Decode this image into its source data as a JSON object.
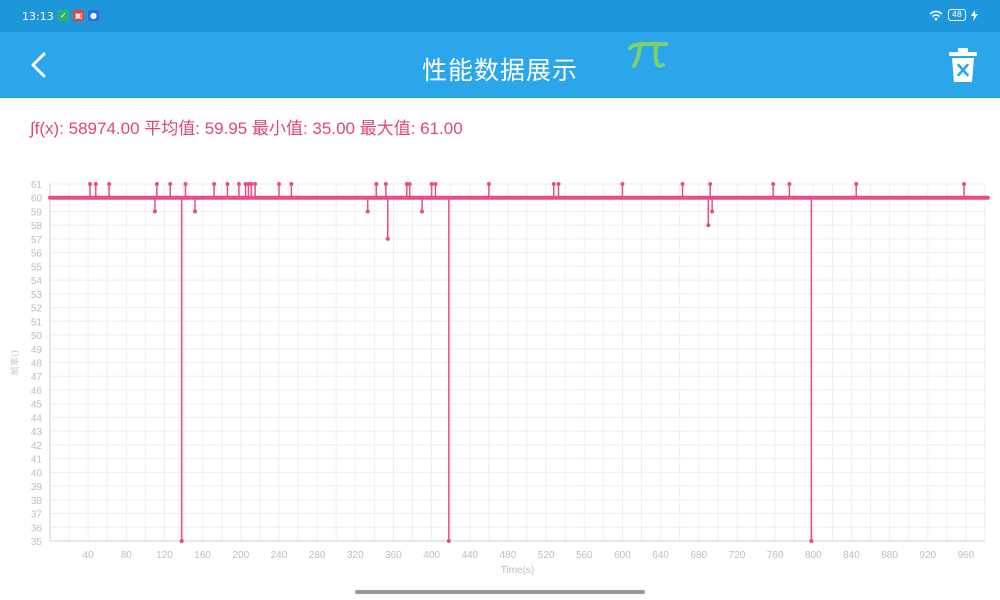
{
  "status_bar": {
    "time": "13:13",
    "battery": "48",
    "colors": {
      "background": "#1e96dc"
    }
  },
  "app_bar": {
    "title": "性能数据展示",
    "back_icon": "chevron-left-icon",
    "delete_icon": "trash-icon",
    "logo_icon": "pi-logo-icon",
    "colors": {
      "background": "#2ba6eb",
      "text": "#ffffff"
    }
  },
  "stats": {
    "text": "∫f(x): 58974.00 平均值: 59.95 最小值: 35.00 最大值: 61.00",
    "color": "#e0457b"
  },
  "chart_data": {
    "type": "line",
    "xlabel": "Time(s)",
    "ylabel": "帧率()",
    "xlim": [
      0,
      980
    ],
    "ylim": [
      35,
      61
    ],
    "xticks": [
      40,
      80,
      120,
      160,
      200,
      240,
      280,
      320,
      360,
      400,
      440,
      480,
      520,
      560,
      600,
      640,
      680,
      720,
      760,
      800,
      840,
      880,
      920,
      960
    ],
    "yticks": [
      35,
      36,
      37,
      38,
      39,
      40,
      41,
      42,
      43,
      44,
      45,
      46,
      47,
      48,
      49,
      50,
      51,
      52,
      53,
      54,
      55,
      56,
      57,
      58,
      59,
      60,
      61
    ],
    "grid": true,
    "color": "#ea4c89",
    "baseline": 60,
    "x_end": 983,
    "deviations": [
      {
        "x": 42,
        "y": 61
      },
      {
        "x": 48,
        "y": 61
      },
      {
        "x": 62,
        "y": 61
      },
      {
        "x": 110,
        "y": 59
      },
      {
        "x": 112,
        "y": 61
      },
      {
        "x": 126,
        "y": 61
      },
      {
        "x": 138,
        "y": 35
      },
      {
        "x": 142,
        "y": 61
      },
      {
        "x": 152,
        "y": 59
      },
      {
        "x": 172,
        "y": 61
      },
      {
        "x": 186,
        "y": 61
      },
      {
        "x": 198,
        "y": 61
      },
      {
        "x": 205,
        "y": 61
      },
      {
        "x": 208,
        "y": 61
      },
      {
        "x": 211,
        "y": 61
      },
      {
        "x": 215,
        "y": 61
      },
      {
        "x": 240,
        "y": 61
      },
      {
        "x": 253,
        "y": 61
      },
      {
        "x": 333,
        "y": 59
      },
      {
        "x": 342,
        "y": 61
      },
      {
        "x": 352,
        "y": 61
      },
      {
        "x": 354,
        "y": 57
      },
      {
        "x": 374,
        "y": 61
      },
      {
        "x": 377,
        "y": 61
      },
      {
        "x": 390,
        "y": 59
      },
      {
        "x": 400,
        "y": 61
      },
      {
        "x": 404,
        "y": 61
      },
      {
        "x": 418,
        "y": 35
      },
      {
        "x": 460,
        "y": 61
      },
      {
        "x": 528,
        "y": 61
      },
      {
        "x": 533,
        "y": 61
      },
      {
        "x": 600,
        "y": 61
      },
      {
        "x": 663,
        "y": 61
      },
      {
        "x": 690,
        "y": 58
      },
      {
        "x": 692,
        "y": 61
      },
      {
        "x": 694,
        "y": 59
      },
      {
        "x": 758,
        "y": 61
      },
      {
        "x": 775,
        "y": 61
      },
      {
        "x": 798,
        "y": 35
      },
      {
        "x": 845,
        "y": 61
      },
      {
        "x": 958,
        "y": 61
      }
    ]
  }
}
